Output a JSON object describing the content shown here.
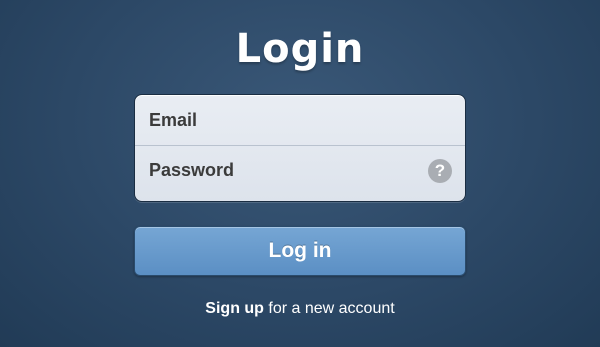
{
  "title": "Login",
  "form": {
    "email_placeholder": "Email",
    "email_value": "",
    "password_placeholder": "Password",
    "password_value": "",
    "help_icon": "question-mark-icon",
    "help_glyph": "?"
  },
  "login_button_label": "Log in",
  "signup": {
    "link_text": "Sign up",
    "rest_text": " for a new account"
  },
  "colors": {
    "background": "#2c4866",
    "button": "#6a9bcc",
    "field_background": "#e4e9f0",
    "help_icon": "#a9adb3"
  }
}
